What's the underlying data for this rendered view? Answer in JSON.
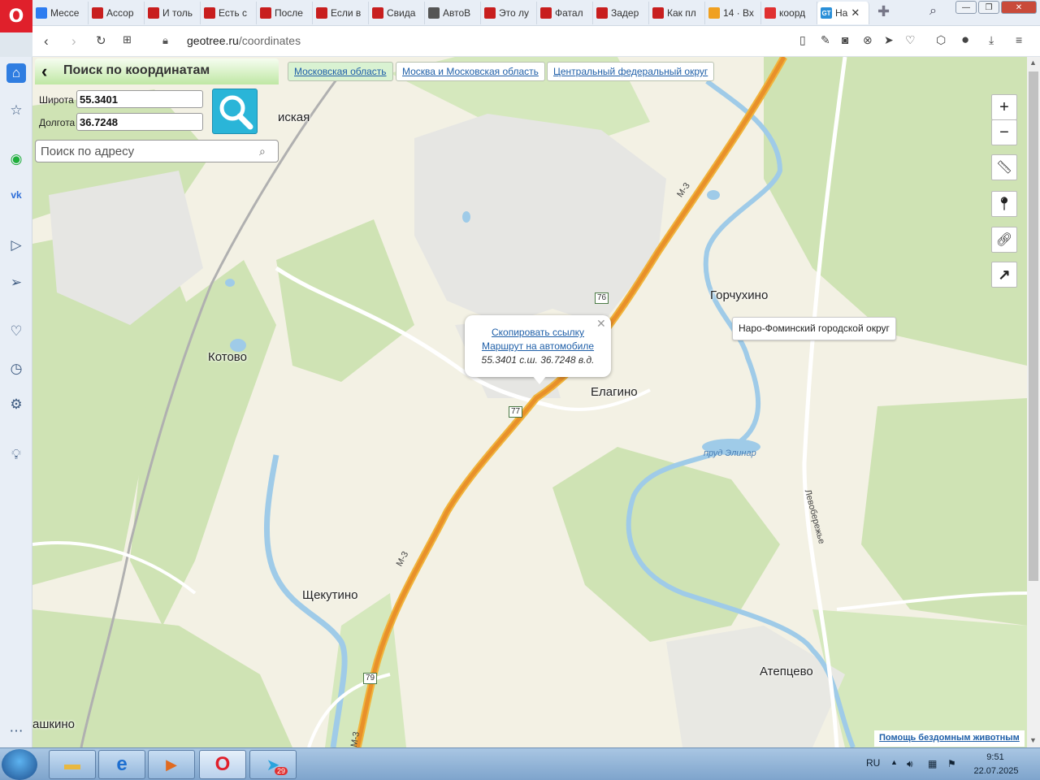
{
  "browser": {
    "logo": "O",
    "tabs": [
      {
        "label": "Мессе",
        "color": "#2d7cf0"
      },
      {
        "label": "Ассор",
        "color": "#c81e1e"
      },
      {
        "label": "И толь",
        "color": "#c81e1e"
      },
      {
        "label": "Есть с",
        "color": "#c81e1e"
      },
      {
        "label": "После",
        "color": "#c81e1e"
      },
      {
        "label": "Если в",
        "color": "#c81e1e"
      },
      {
        "label": "Свида",
        "color": "#c81e1e"
      },
      {
        "label": "АвтоВ",
        "color": "#555555"
      },
      {
        "label": "Это лу",
        "color": "#c81e1e"
      },
      {
        "label": "Фатал",
        "color": "#c81e1e"
      },
      {
        "label": "Задер",
        "color": "#c81e1e"
      },
      {
        "label": "Как пл",
        "color": "#c81e1e"
      },
      {
        "label": "14 · Вх",
        "color": "#f0a020"
      },
      {
        "label": "коорд",
        "color": "#e03030"
      }
    ],
    "active_tab": {
      "label": "На",
      "icon": "GT"
    },
    "url_host": "geotree.ru",
    "url_path": "/coordinates"
  },
  "search_panel": {
    "title": "Поиск по координатам",
    "lat_label": "Широта",
    "lat_value": "55.3401",
    "lon_label": "Долгота",
    "lon_value": "36.7248",
    "address_placeholder": "Поиск по адресу"
  },
  "regions": [
    "Московская область",
    "Москва и Московская область",
    "Центральный федеральный округ"
  ],
  "map": {
    "places": {
      "kotovo": "Котово",
      "gorchukhino": "Горчухино",
      "elagino": "Елагино",
      "shchekutino": "Щекутино",
      "atepcevo": "Атепцево",
      "ashkino": "ашкино",
      "top_left": "иская"
    },
    "pond": "пруд Элинар",
    "road_numbers": {
      "r76": "76",
      "r77": "77",
      "r79": "79"
    },
    "road_m3": "М-3",
    "street": "Левобережье"
  },
  "popup": {
    "copy_link": "Скопировать ссылку",
    "route": "Маршрут на автомобиле",
    "coords": "55.3401 с.ш. 36.7248 в.д."
  },
  "district_tooltip": "Наро-Фоминский городской округ",
  "help_link": "Помощь бездомным животным",
  "controls": {
    "zoom_in": "+",
    "zoom_out": "−"
  },
  "taskbar": {
    "lang": "RU",
    "time": "9:51",
    "date": "22.07.2025",
    "telegram_badge": "29"
  }
}
